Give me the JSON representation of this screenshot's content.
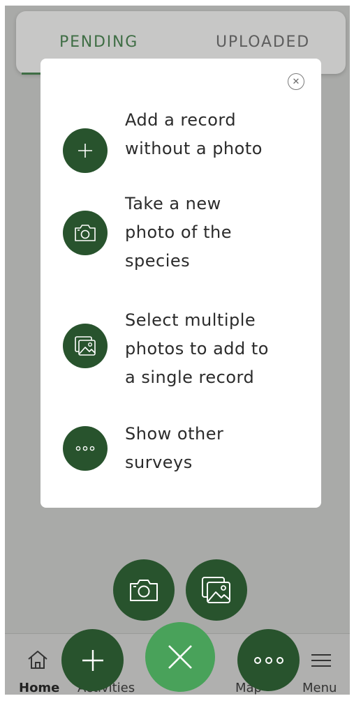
{
  "tabs": {
    "pending": "PENDING",
    "uploaded": "UPLOADED"
  },
  "modal": {
    "options": [
      {
        "text_lines": [
          "Add a record",
          "without a photo"
        ],
        "icon": "plus-icon"
      },
      {
        "text_lines": [
          "Take a new",
          "photo of the",
          "species"
        ],
        "icon": "camera-icon"
      },
      {
        "text_lines": [
          "Select multiple",
          "photos to add to",
          "a single record"
        ],
        "icon": "gallery-icon"
      },
      {
        "text_lines": [
          "Show other",
          "surveys"
        ],
        "icon": "more-dots-icon"
      }
    ]
  },
  "bottom_nav": {
    "home": "Home",
    "activities": "Activities",
    "map": "Map",
    "menu": "Menu"
  },
  "colors": {
    "dark_green": "#28532d",
    "light_green": "#49a25a",
    "overlay": "#a9aaa8"
  }
}
